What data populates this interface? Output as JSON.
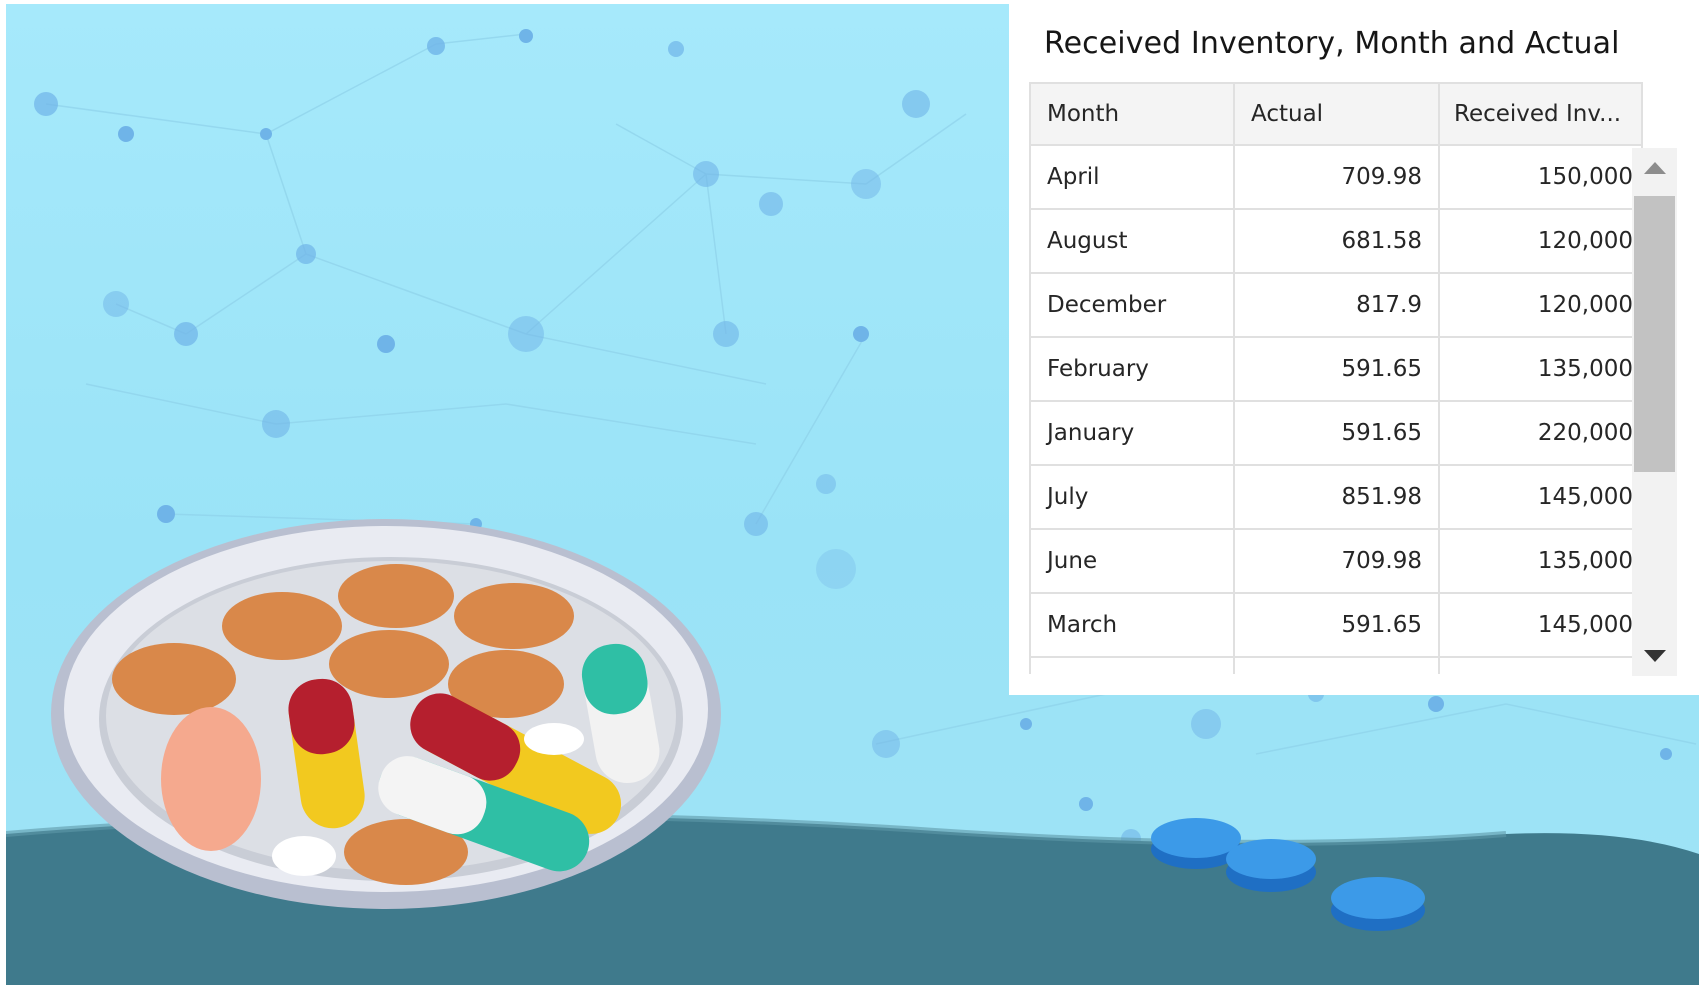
{
  "widget": {
    "title": "Received Inventory, Month and Actual",
    "columns": [
      "Month",
      "Actual",
      "Received Inv..."
    ],
    "rows": [
      {
        "month": "April",
        "actual": "709.98",
        "received": "150,000"
      },
      {
        "month": "August",
        "actual": "681.58",
        "received": "120,000"
      },
      {
        "month": "December",
        "actual": "817.9",
        "received": "120,000"
      },
      {
        "month": "February",
        "actual": "591.65",
        "received": "135,000"
      },
      {
        "month": "January",
        "actual": "591.65",
        "received": "220,000"
      },
      {
        "month": "July",
        "actual": "851.98",
        "received": "145,000"
      },
      {
        "month": "June",
        "actual": "709.98",
        "received": "135,000"
      },
      {
        "month": "March",
        "actual": "591.65",
        "received": "145,000"
      },
      {
        "month": "",
        "actual": "",
        "received": ""
      }
    ]
  },
  "colors": {
    "background_sky": "#9ae3f7",
    "floor": "#3f7a8c",
    "panel": "#ffffff",
    "header": "#f4f4f4",
    "gridline": "#e0e0e0"
  },
  "icons": {
    "scroll_up": "triangle-up",
    "scroll_down": "triangle-down"
  }
}
